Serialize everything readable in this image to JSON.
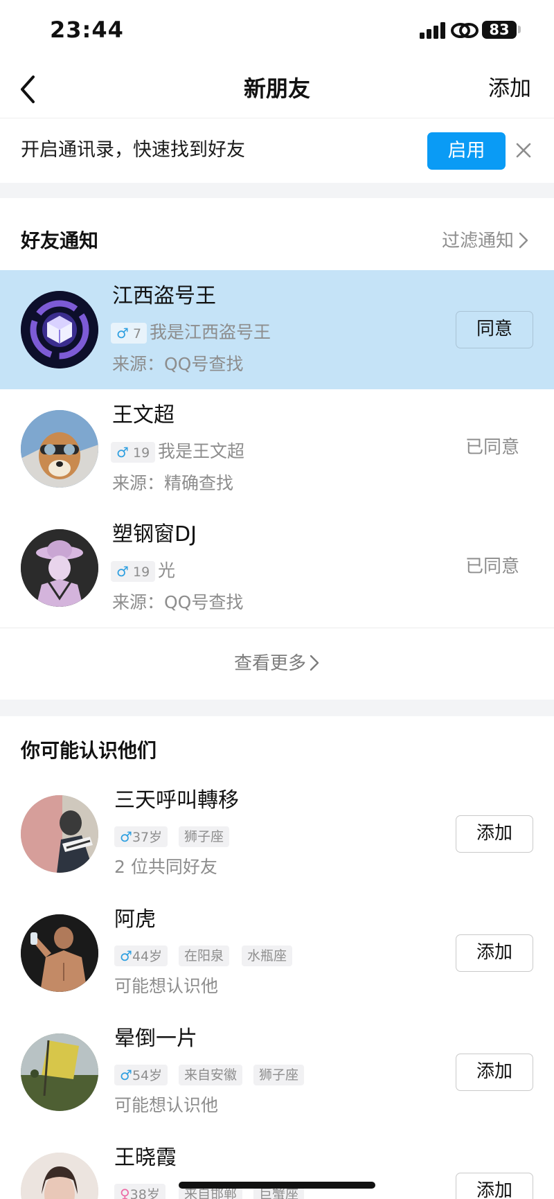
{
  "status_bar": {
    "time": "23:44",
    "battery": "83"
  },
  "nav": {
    "title": "新朋友",
    "add_label": "添加"
  },
  "banner": {
    "text": "开启通讯录，快速找到好友",
    "enable_label": "启用"
  },
  "notifications": {
    "title": "好友通知",
    "filter_label": "过滤通知",
    "items": [
      {
        "name": "江西盗号王",
        "gender": "♂",
        "age": "7",
        "message": "我是江西盗号王",
        "source": "来源：QQ号查找",
        "action": "同意"
      },
      {
        "name": "王文超",
        "gender": "♂",
        "age": "19",
        "message": "我是王文超",
        "source": "来源：精确查找",
        "status": "已同意"
      },
      {
        "name": "塑钢窗DJ",
        "gender": "♂",
        "age": "19",
        "message": "光",
        "source": "来源：QQ号查找",
        "status": "已同意"
      }
    ],
    "see_more": "查看更多"
  },
  "suggestions": {
    "title": "你可能认识他们",
    "items": [
      {
        "name": "三天呼叫轉移",
        "gender": "♂",
        "age": "37岁",
        "tags": [
          "狮子座"
        ],
        "note": "2 位共同好友",
        "action": "添加"
      },
      {
        "name": "阿虎",
        "gender": "♂",
        "age": "44岁",
        "tags": [
          "在阳泉",
          "水瓶座"
        ],
        "note": "可能想认识他",
        "action": "添加"
      },
      {
        "name": "晕倒一片",
        "gender": "♂",
        "age": "54岁",
        "tags": [
          "来自安徽",
          "狮子座"
        ],
        "note": "可能想认识他",
        "action": "添加"
      },
      {
        "name": "王晓霞",
        "gender": "♀",
        "age": "38岁",
        "tags": [
          "来自邯郸",
          "巨蟹座"
        ],
        "action": "添加"
      }
    ]
  }
}
